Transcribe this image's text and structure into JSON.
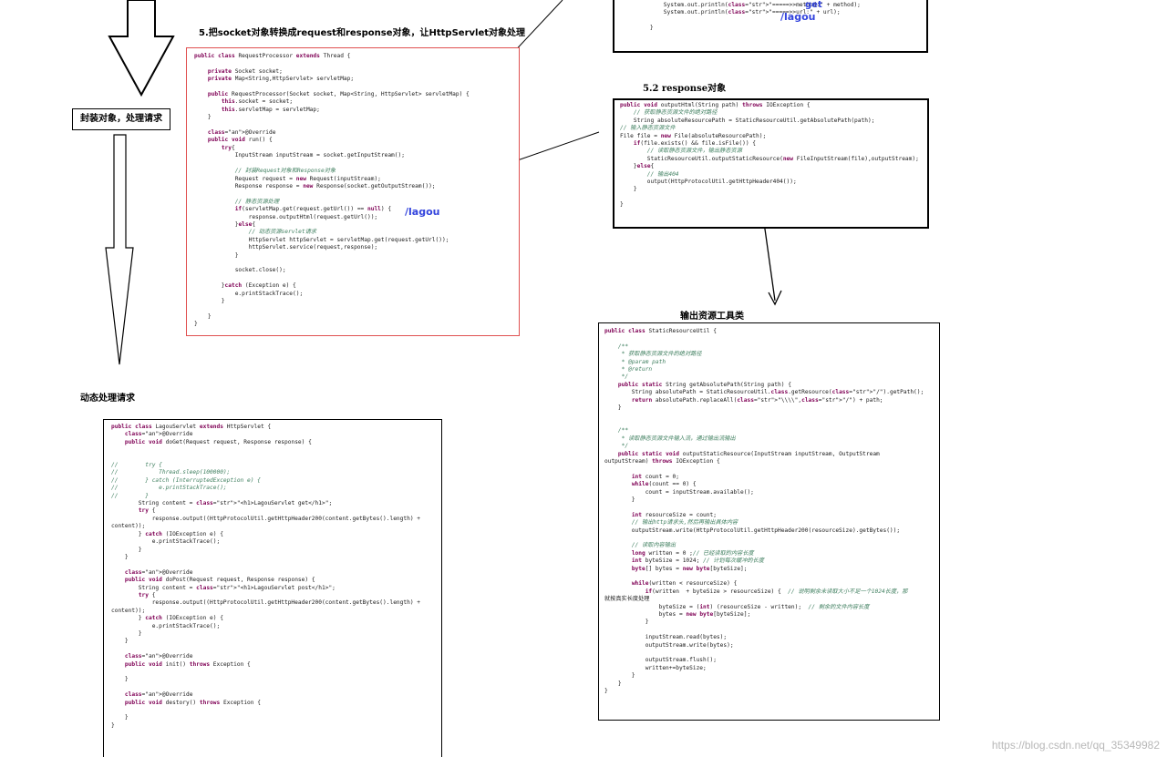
{
  "headings": {
    "socket_wrap": "5.把socket对象转换成request和response对象，让HttpServlet对象处理",
    "encapsulate": "封装对象，处理请求",
    "response_obj": "5.2  response对象",
    "output_util": "输出资源工具类",
    "dynamic": "动态处理请求"
  },
  "annotations": {
    "get": "get",
    "lagou_top": "/lagou",
    "lagou_mid": "/lagou"
  },
  "watermark": "https://blog.csdn.net/qq_35349982",
  "code_top_partial": [
    "        System.out.println(\"=====>>method:\" + method);",
    "        System.out.println(\"=====>>url:\" + url);",
    "",
    "    }"
  ],
  "code_request_processor": [
    "public class RequestProcessor extends Thread {",
    "",
    "    private Socket socket;",
    "    private Map<String,HttpServlet> servletMap;",
    "",
    "    public RequestProcessor(Socket socket, Map<String, HttpServlet> servletMap) {",
    "        this.socket = socket;",
    "        this.servletMap = servletMap;",
    "    }",
    "",
    "    @Override",
    "    public void run() {",
    "        try{",
    "            InputStream inputStream = socket.getInputStream();",
    "",
    "            // 封装Request对象和Response对象",
    "            Request request = new Request(inputStream);",
    "            Response response = new Response(socket.getOutputStream());",
    "",
    "            // 静态资源处理",
    "            if(servletMap.get(request.getUrl()) == null) {",
    "                response.outputHtml(request.getUrl());",
    "            }else{",
    "                // 动态资源servlet请求",
    "                HttpServlet httpServlet = servletMap.get(request.getUrl());",
    "                httpServlet.service(request,response);",
    "            }",
    "",
    "            socket.close();",
    "",
    "        }catch (Exception e) {",
    "            e.printStackTrace();",
    "        }",
    "",
    "    }",
    "}"
  ],
  "code_output_html": [
    "public void outputHtml(String path) throws IOException {",
    "    // 获取静态资源文件的绝对路径",
    "    String absoluteResourcePath = StaticResourceUtil.getAbsolutePath(path);",
    "// 输入静态资源文件",
    "File file = new File(absoluteResourcePath);",
    "    if(file.exists() && file.isFile()) {",
    "        // 读取静态资源文件，输出静态资源",
    "        StaticResourceUtil.outputStaticResource(new FileInputStream(file),outputStream);",
    "    }else{",
    "        // 输出404",
    "        output(HttpProtocolUtil.getHttpHeader404());",
    "    }",
    "",
    "}"
  ],
  "code_static_resource_util": [
    "public class StaticResourceUtil {",
    "",
    "    /**",
    "     * 获取静态资源文件的绝对路径",
    "     * @param path",
    "     * @return",
    "     */",
    "    public static String getAbsolutePath(String path) {",
    "        String absolutePath = StaticResourceUtil.class.getResource(\"/\").getPath();",
    "        return absolutePath.replaceAll(\"\\\\\\\\\",\"/\") + path;",
    "    }",
    "",
    "",
    "    /**",
    "     * 读取静态资源文件输入流，通过输出流输出",
    "     */",
    "    public static void outputStaticResource(InputStream inputStream, OutputStream",
    "outputStream) throws IOException {",
    "",
    "        int count = 0;",
    "        while(count == 0) {",
    "            count = inputStream.available();",
    "        }",
    "",
    "        int resourceSize = count;",
    "        // 输出http请求头,然后再输出具体内容",
    "        outputStream.write(HttpProtocolUtil.getHttpHeader200(resourceSize).getBytes());",
    "",
    "        // 读取内容输出",
    "        long written = 0 ;// 已经读取的内容长度",
    "        int byteSize = 1024; // 计划每次缓冲的长度",
    "        byte[] bytes = new byte[byteSize];",
    "",
    "        while(written < resourceSize) {",
    "            if(written  + byteSize > resourceSize) {  // 说明剩余未读取大小不足一个1024长度，那",
    "就按真实长度处理",
    "                byteSize = (int) (resourceSize - written);  // 剩余的文件内容长度",
    "                bytes = new byte[byteSize];",
    "            }",
    "",
    "            inputStream.read(bytes);",
    "            outputStream.write(bytes);",
    "",
    "            outputStream.flush();",
    "            written+=byteSize;",
    "        }",
    "    }",
    "}"
  ],
  "code_lagou_servlet": [
    "public class LagouServlet extends HttpServlet {",
    "    @Override",
    "    public void doGet(Request request, Response response) {",
    "",
    "",
    "//        try {",
    "//            Thread.sleep(100000);",
    "//        } catch (InterruptedException e) {",
    "//            e.printStackTrace();",
    "//        }",
    "        String content = \"<h1>LagouServlet get</h1>\";",
    "        try {",
    "            response.output((HttpProtocolUtil.getHttpHeader200(content.getBytes().length) +",
    "content));",
    "        } catch (IOException e) {",
    "            e.printStackTrace();",
    "        }",
    "    }",
    "",
    "    @Override",
    "    public void doPost(Request request, Response response) {",
    "        String content = \"<h1>LagouServlet post</h1>\";",
    "        try {",
    "            response.output((HttpProtocolUtil.getHttpHeader200(content.getBytes().length) +",
    "content));",
    "        } catch (IOException e) {",
    "            e.printStackTrace();",
    "        }",
    "    }",
    "",
    "    @Override",
    "    public void init() throws Exception {",
    "",
    "    }",
    "",
    "    @Override",
    "    public void destory() throws Exception {",
    "",
    "    }",
    "}"
  ]
}
